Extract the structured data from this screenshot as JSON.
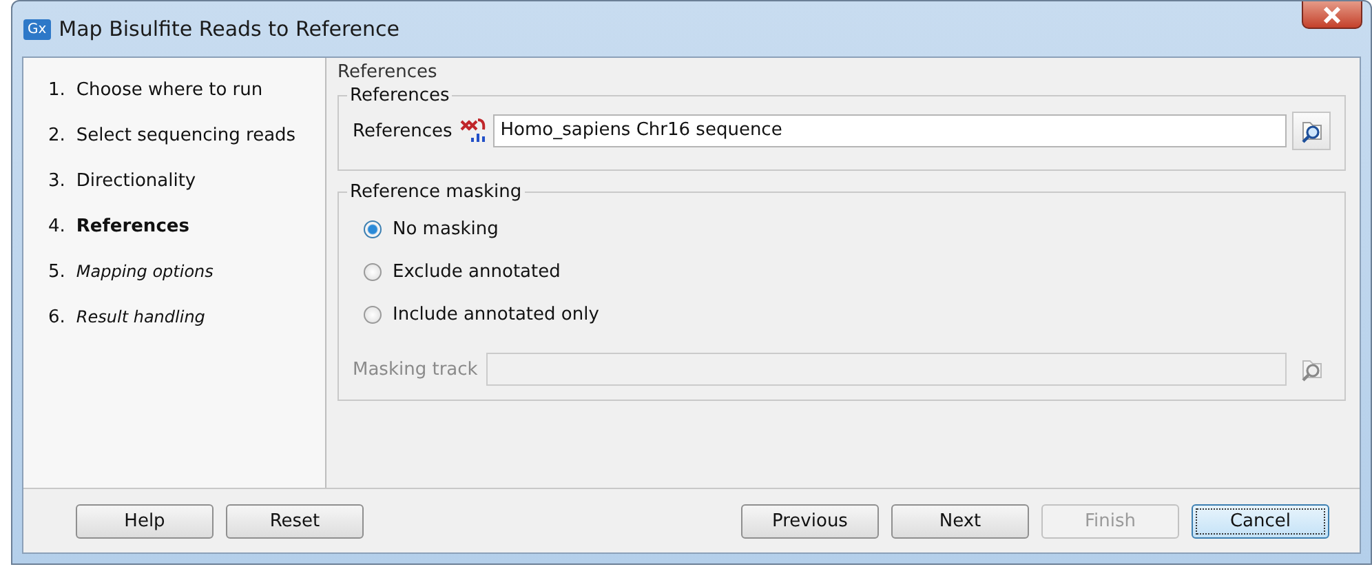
{
  "window": {
    "title": "Map Bisulfite Reads to Reference",
    "app_badge": "Gx"
  },
  "steps": [
    {
      "number": "1.",
      "label": "Choose where to run",
      "current": false,
      "visited": true
    },
    {
      "number": "2.",
      "label": "Select sequencing reads",
      "current": false,
      "visited": true
    },
    {
      "number": "3.",
      "label": "Directionality",
      "current": false,
      "visited": true
    },
    {
      "number": "4.",
      "label": "References",
      "current": true,
      "visited": true
    },
    {
      "number": "5.",
      "label": "Mapping options",
      "current": false,
      "visited": false
    },
    {
      "number": "6.",
      "label": "Result handling",
      "current": false,
      "visited": false
    }
  ],
  "page_title": "References",
  "references_group": {
    "title": "References",
    "field_label": "References",
    "value": "Homo_sapiens Chr16 sequence",
    "disabled": false
  },
  "masking_group": {
    "title": "Reference masking",
    "options": [
      {
        "label": "No masking",
        "selected": true
      },
      {
        "label": "Exclude annotated",
        "selected": false
      },
      {
        "label": "Include annotated only",
        "selected": false
      }
    ],
    "track": {
      "label": "Masking track",
      "disabled": true
    }
  },
  "buttons": [
    {
      "label": "Help",
      "disabled": false,
      "focused": false
    },
    {
      "label": "Reset",
      "disabled": false,
      "focused": false
    }
  ],
  "nav_buttons": [
    {
      "label": "Previous",
      "disabled": false,
      "focused": false
    },
    {
      "label": "Next",
      "disabled": false,
      "focused": false
    },
    {
      "label": "Finish",
      "disabled": true,
      "focused": false
    },
    {
      "label": "Cancel",
      "disabled": false,
      "focused": true
    }
  ]
}
